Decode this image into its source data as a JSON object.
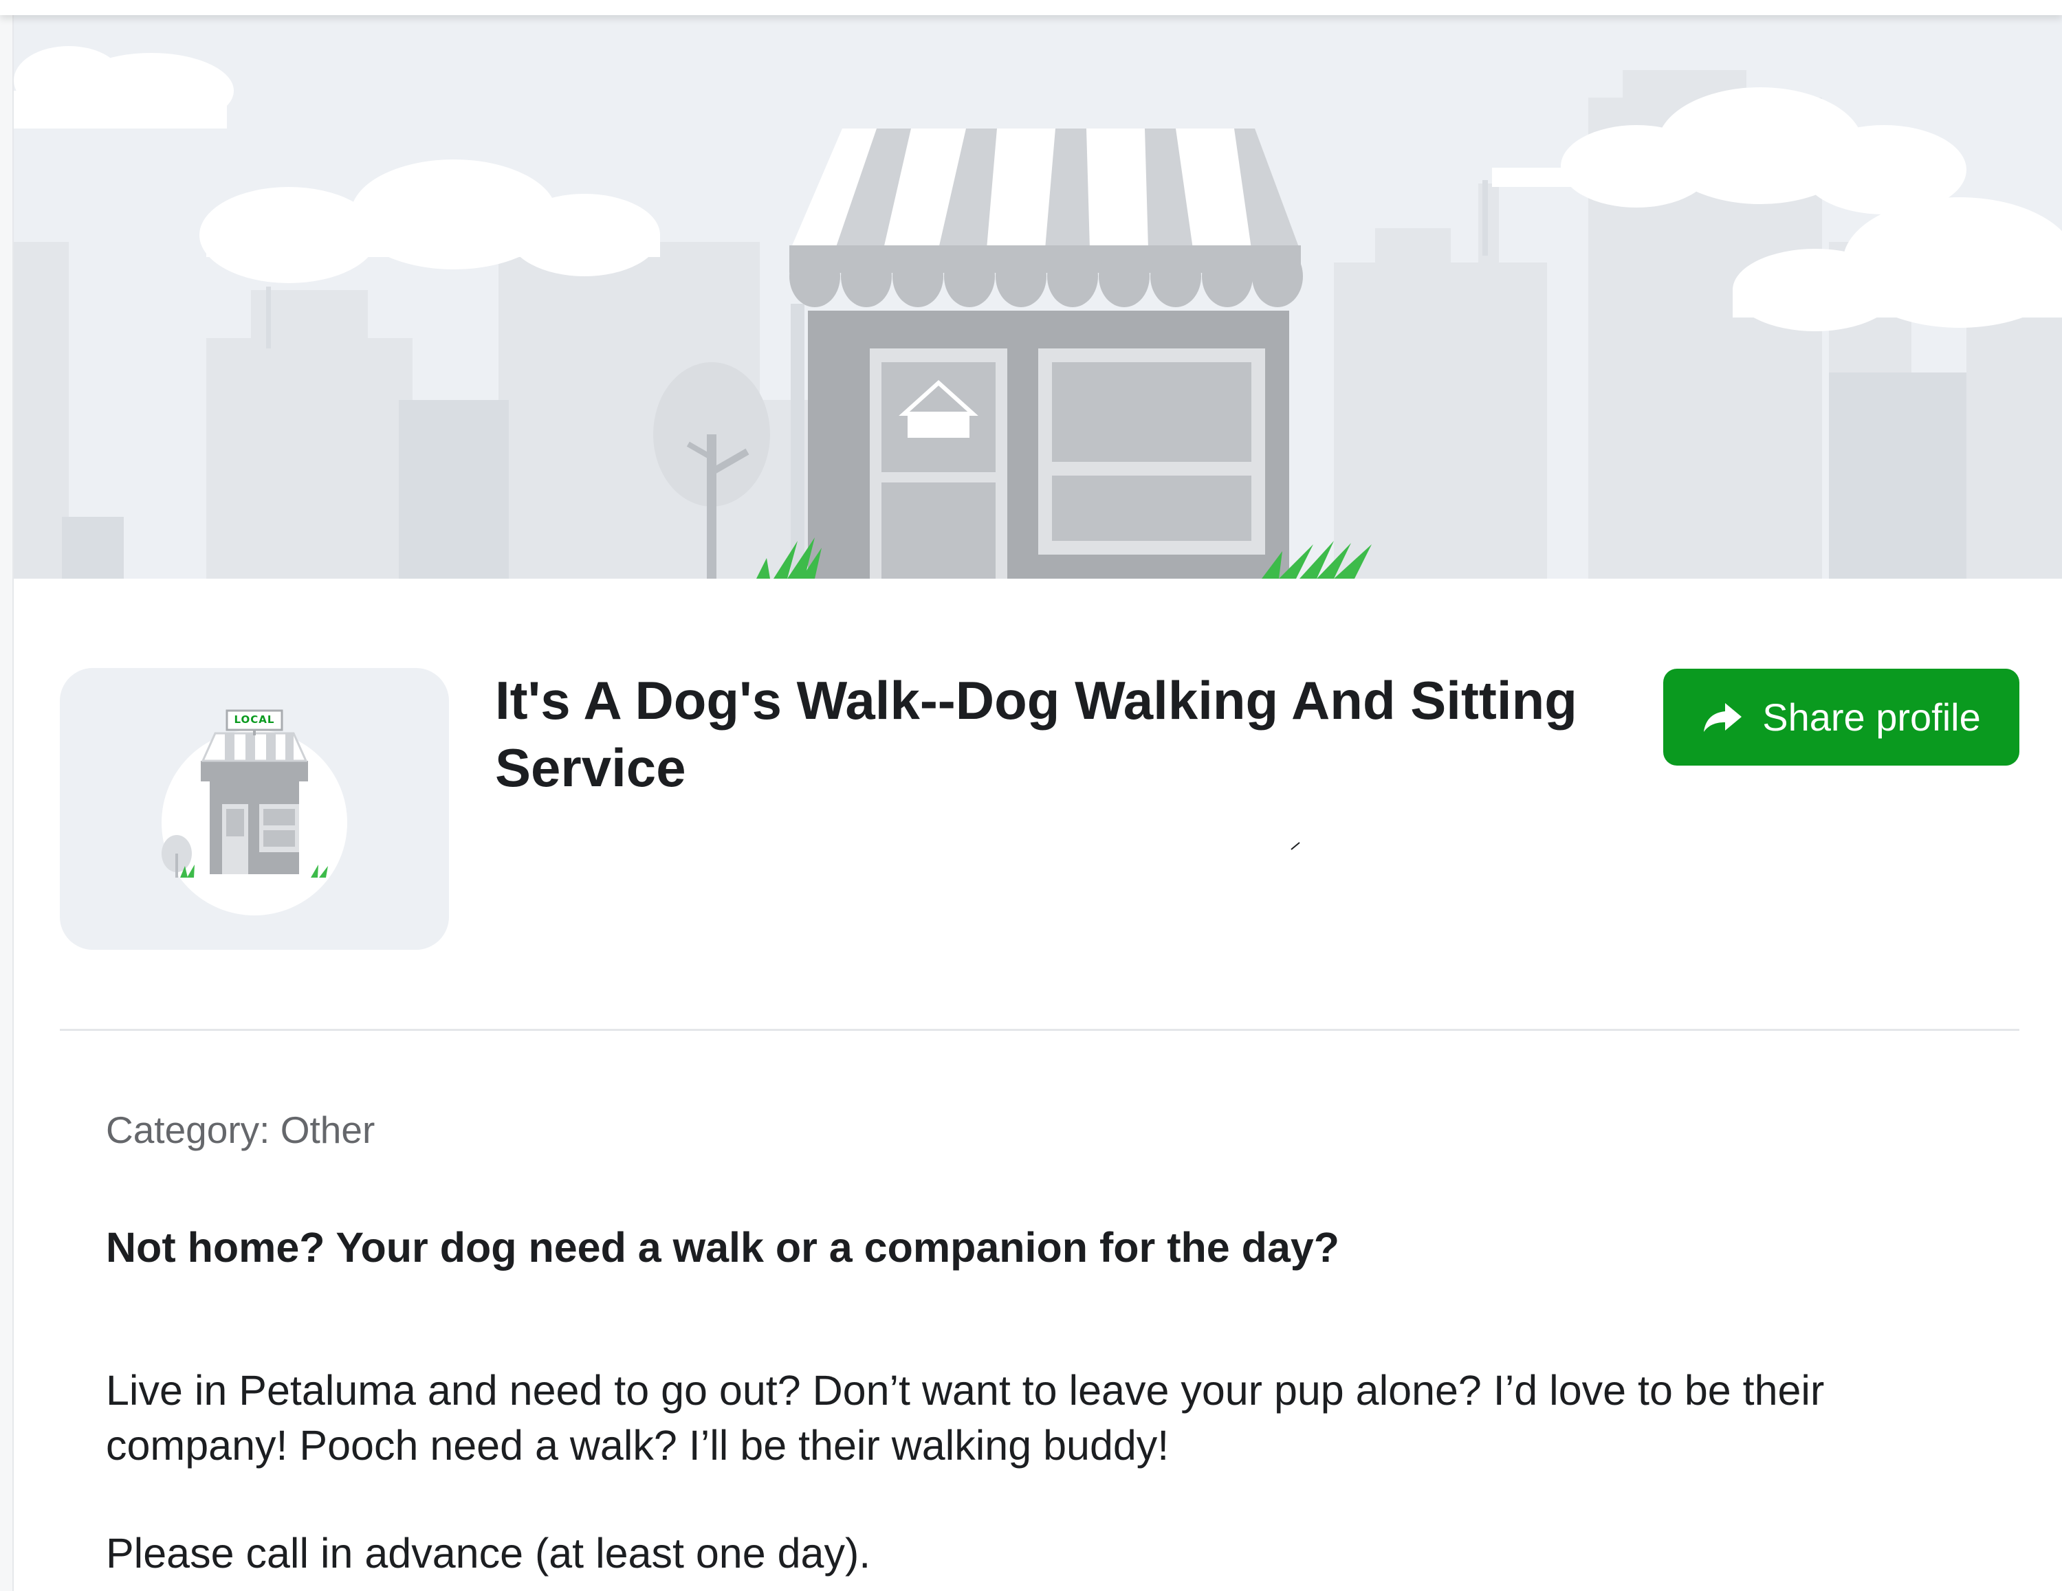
{
  "business": {
    "name": "It's A Dog's Walk--Dog Walking And Sitting Service",
    "logo_sign": "LOCAL"
  },
  "actions": {
    "share_label": "Share profile",
    "share_icon": "share-arrow-icon"
  },
  "details": {
    "category": "Category: Other",
    "headline": "Not home? Your dog need a walk or a companion for the day?",
    "paragraph_1": "Live in Petaluma and need to go out? Don’t want to leave your pup alone? I’d love to be their company! Pooch need a walk? I’ll be their walking buddy!",
    "paragraph_2": "Please call in advance (at least one day)."
  },
  "colors": {
    "accent": "#0a9a1f",
    "banner_bg": "#edf0f4",
    "text": "#1c1e21",
    "muted": "#65676b"
  }
}
